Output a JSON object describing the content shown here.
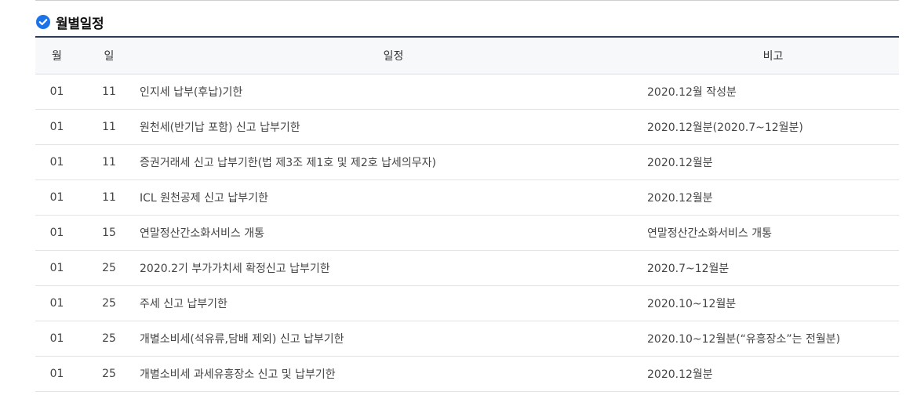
{
  "section": {
    "title": "월별일정",
    "icon": "check-circle-icon",
    "icon_color": "#1a73e8"
  },
  "table": {
    "headers": {
      "month": "월",
      "day": "일",
      "event": "일정",
      "note": "비고"
    },
    "rows": [
      {
        "month": "01",
        "day": "11",
        "event": "인지세 납부(후납)기한",
        "note": "2020.12월 작성분"
      },
      {
        "month": "01",
        "day": "11",
        "event": "원천세(반기납 포함) 신고 납부기한",
        "note": "2020.12월분(2020.7~12월분)"
      },
      {
        "month": "01",
        "day": "11",
        "event": "증권거래세 신고 납부기한(법 제3조 제1호 및 제2호 납세의무자)",
        "note": "2020.12월분"
      },
      {
        "month": "01",
        "day": "11",
        "event": "ICL 원천공제 신고 납부기한",
        "note": "2020.12월분"
      },
      {
        "month": "01",
        "day": "15",
        "event": "연말정산간소화서비스 개통",
        "note": "연말정산간소화서비스 개통"
      },
      {
        "month": "01",
        "day": "25",
        "event": "2020.2기 부가가치세 확정신고 납부기한",
        "note": "2020.7~12월분"
      },
      {
        "month": "01",
        "day": "25",
        "event": "주세 신고 납부기한",
        "note": "2020.10~12월분"
      },
      {
        "month": "01",
        "day": "25",
        "event": "개별소비세(석유류,담배 제외) 신고 납부기한",
        "note": "2020.10~12월분(“유흥장소”는 전월분)"
      },
      {
        "month": "01",
        "day": "25",
        "event": "개별소비세 과세유흥장소 신고 및 납부기한",
        "note": "2020.12월분"
      }
    ]
  }
}
